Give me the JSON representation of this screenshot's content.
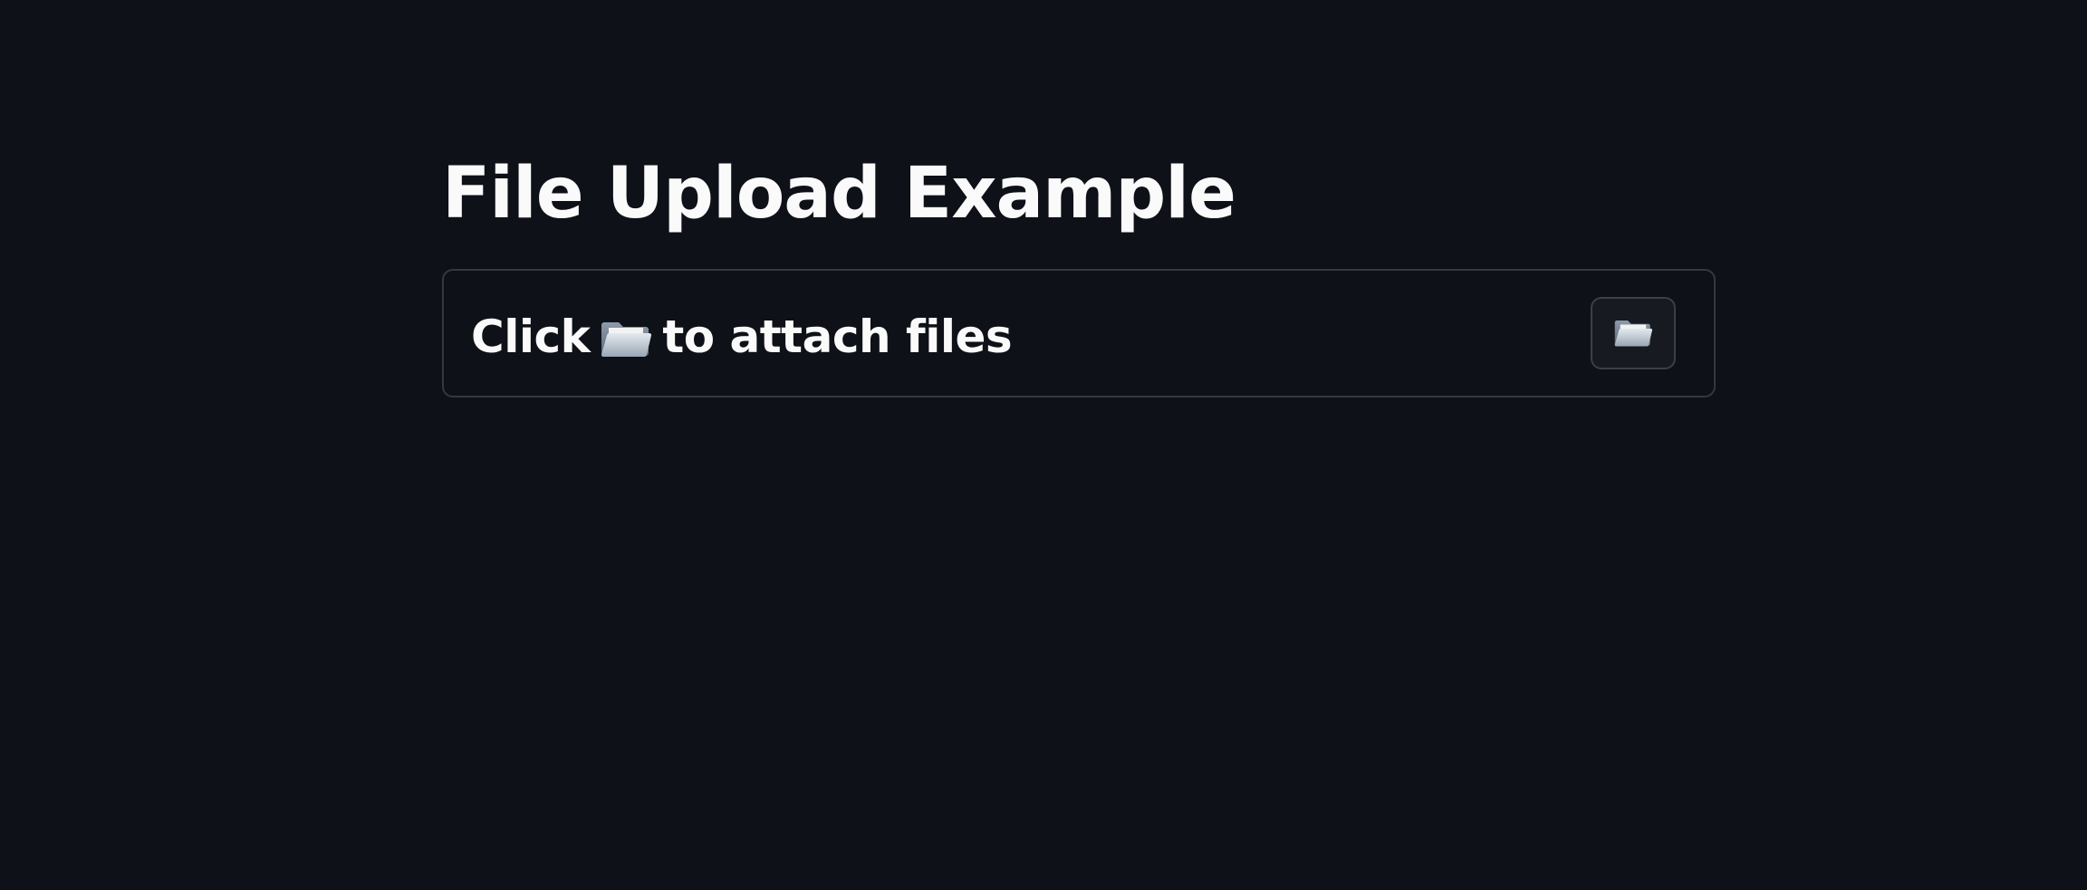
{
  "page": {
    "title": "File Upload Example"
  },
  "uploader": {
    "prompt_before": "Click",
    "prompt_after": "to attach files",
    "inline_icon": "open-folder-icon",
    "button_icon": "open-folder-icon"
  },
  "colors": {
    "background": "#0e1117",
    "text": "#fafafa",
    "border": "#363840",
    "button_bg": "#171a21"
  }
}
